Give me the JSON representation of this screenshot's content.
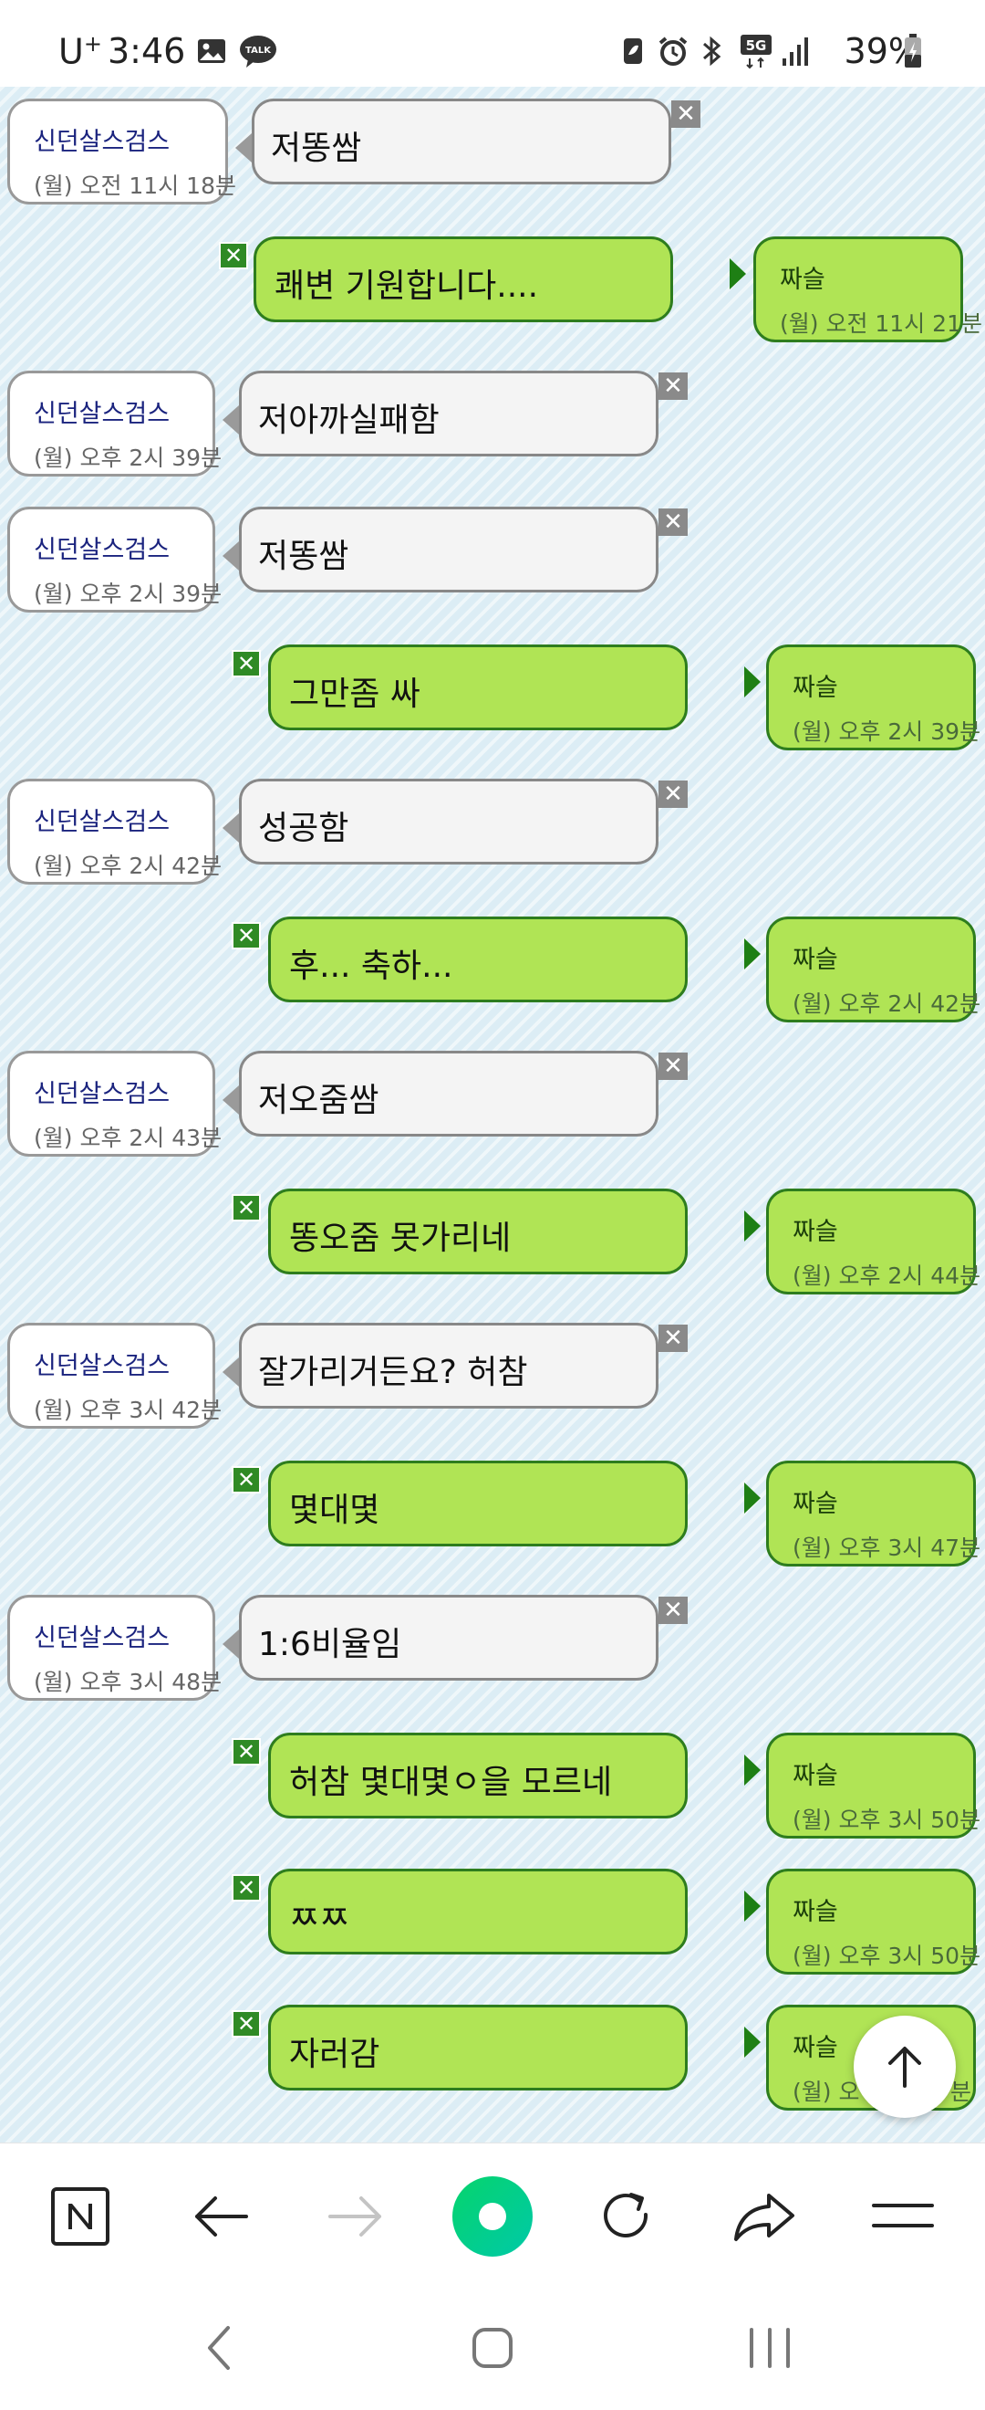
{
  "status_bar": {
    "carrier": "U",
    "carrier_sup": "+",
    "time": "3:46",
    "network": "5G",
    "battery": "39%"
  },
  "colors": {
    "incoming_bubble": "#f4f4f4",
    "outgoing_bubble": "#b0e455",
    "outgoing_border": "#2e7d1e",
    "name_color": "#1a237e",
    "background": "#dcedf5"
  },
  "messages": [
    {
      "dir": "in",
      "name": "신던살스검스",
      "time": "(월) 오전 11시 18분",
      "text": "저똥쌈"
    },
    {
      "dir": "out",
      "name": "짜슬",
      "time": "(월) 오전 11시 21분",
      "text": "쾌변 기원합니다...."
    },
    {
      "dir": "in",
      "name": "신던살스검스",
      "time": "(월) 오후 2시 39분",
      "text": "저아까실패함"
    },
    {
      "dir": "in",
      "name": "신던살스검스",
      "time": "(월) 오후 2시 39분",
      "text": "저똥쌈"
    },
    {
      "dir": "out",
      "name": "짜슬",
      "time": "(월) 오후 2시 39분",
      "text": "그만좀 싸"
    },
    {
      "dir": "in",
      "name": "신던살스검스",
      "time": "(월) 오후 2시 42분",
      "text": "성공함"
    },
    {
      "dir": "out",
      "name": "짜슬",
      "time": "(월) 오후 2시 42분",
      "text": "후... 축하..."
    },
    {
      "dir": "in",
      "name": "신던살스검스",
      "time": "(월) 오후 2시 43분",
      "text": "저오줌쌈"
    },
    {
      "dir": "out",
      "name": "짜슬",
      "time": "(월) 오후 2시 44분",
      "text": "똥오줌 못가리네"
    },
    {
      "dir": "in",
      "name": "신던살스검스",
      "time": "(월) 오후 3시 42분",
      "text": "잘가리거든요? 허참"
    },
    {
      "dir": "out",
      "name": "짜슬",
      "time": "(월) 오후 3시 47분",
      "text": "몇대몇"
    },
    {
      "dir": "in",
      "name": "신던살스검스",
      "time": "(월) 오후 3시 48분",
      "text": "1:6비율임"
    },
    {
      "dir": "out",
      "name": "짜슬",
      "time": "(월) 오후 3시 50분",
      "text": "허참 몇대몇ㅇ을 모르네"
    },
    {
      "dir": "out",
      "name": "짜슬",
      "time": "(월) 오후 3시 50분",
      "text": "ㅉㅉ"
    },
    {
      "dir": "out",
      "name": "짜슬",
      "time": "(월) 오",
      "time_tail": "분",
      "text": "자러감"
    }
  ],
  "toolbar": {
    "icons": [
      "naver-home-icon",
      "back-arrow-icon",
      "forward-arrow-icon",
      "green-dot-icon",
      "refresh-icon",
      "share-icon",
      "menu-icon"
    ]
  },
  "system_nav": {
    "icons": [
      "nav-back-icon",
      "nav-home-icon",
      "nav-recents-icon"
    ]
  }
}
